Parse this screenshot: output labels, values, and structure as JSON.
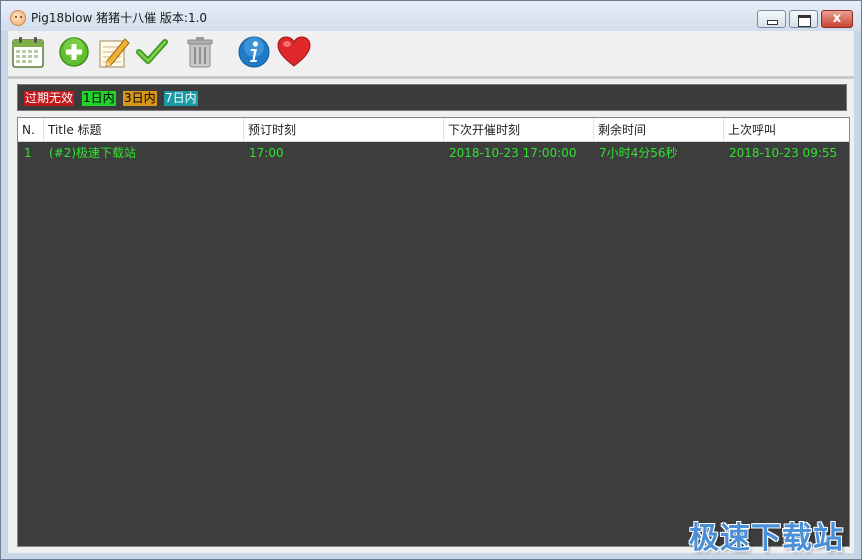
{
  "window": {
    "title": "Pig18blow 猪猪十八催 版本:1.0",
    "controls": {
      "minimize_icon": "minimize-icon",
      "maximize_icon": "maximize-icon",
      "close_label": "x"
    }
  },
  "toolbar": {
    "buttons": [
      {
        "name": "calendar",
        "icon": "calendar-icon"
      },
      {
        "name": "add",
        "icon": "plus-circle-icon"
      },
      {
        "name": "edit",
        "icon": "pencil-notepad-icon"
      },
      {
        "name": "confirm",
        "icon": "checkmark-icon"
      },
      {
        "name": "delete",
        "icon": "trash-can-icon"
      },
      {
        "name": "info",
        "icon": "info-icon"
      },
      {
        "name": "favorite",
        "icon": "heart-icon"
      }
    ]
  },
  "legend": {
    "expired": "过期无效",
    "within_1_day": "1日内",
    "within_3_days": "3日内",
    "within_7_days": "7日内",
    "colors": {
      "expired": "#c0181b",
      "within_1_day": "#22d42a",
      "within_3_days": "#d7951a",
      "within_7_days": "#1a9aa4"
    }
  },
  "list": {
    "columns": {
      "n": "N.",
      "title": "Title 标题",
      "scheduled": "预订时刻",
      "next_reminder": "下次开催时刻",
      "remaining": "剩余时间",
      "last_call": "上次呼叫"
    },
    "rows": [
      {
        "n": "1",
        "title": "(#2)极速下载站",
        "scheduled": "17:00",
        "next_reminder": "2018-10-23 17:00:00",
        "remaining": "7小时4分56秒",
        "last_call": "2018-10-23 09:55"
      }
    ]
  },
  "watermark": "极速下载站"
}
